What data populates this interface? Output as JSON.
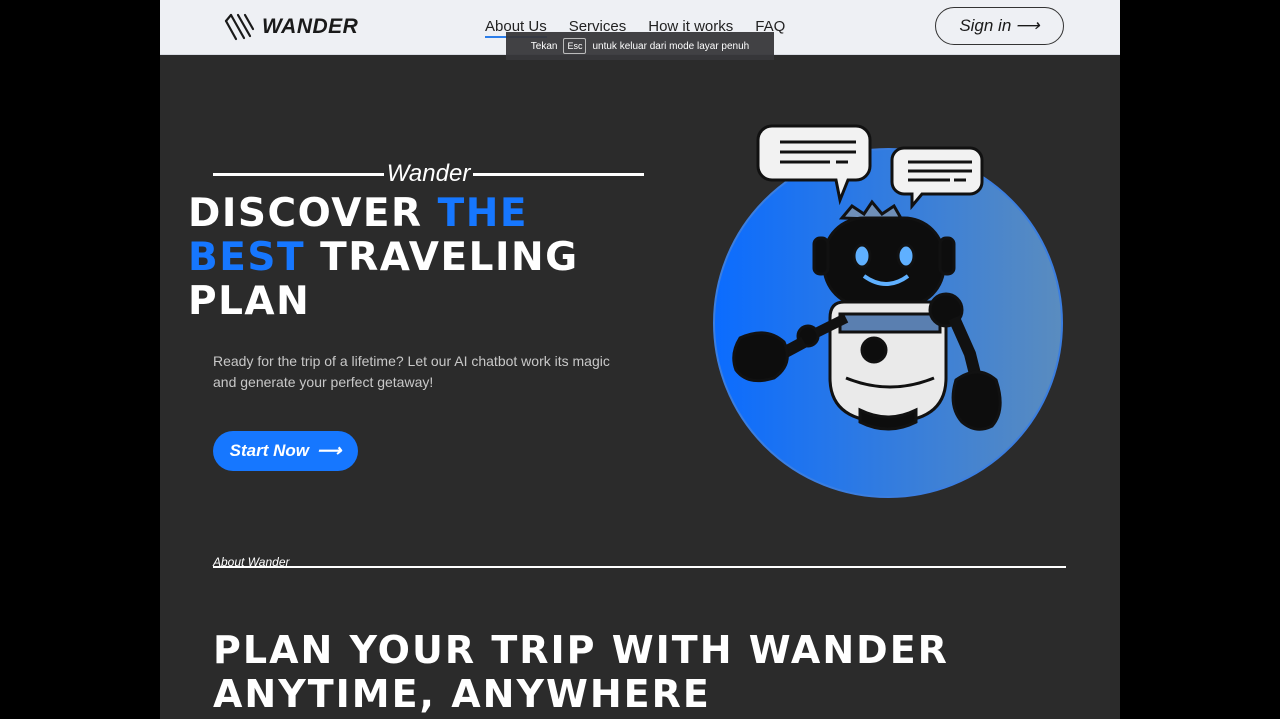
{
  "header": {
    "logo_text": "WANDER",
    "nav": [
      {
        "label": "About Us",
        "active": true
      },
      {
        "label": "Services"
      },
      {
        "label": "How it works"
      },
      {
        "label": "FAQ"
      }
    ],
    "signin_label": "Sign in",
    "signin_arrow": "⟶"
  },
  "fullscreen_toast": {
    "prefix": "Tekan",
    "key": "Esc",
    "suffix": "untuk keluar dari mode layar penuh"
  },
  "hero": {
    "eyebrow": "Wander",
    "headline": {
      "part1": "DISCOVER ",
      "part2_blue": "THE BEST",
      "part3": " TRAVELING PLAN"
    },
    "description": "Ready for the trip of a lifetime? Let our AI chatbot work its magic and generate your perfect getaway!",
    "cta_label": "Start Now",
    "cta_arrow": "⟶"
  },
  "about": {
    "label": "About Wander",
    "heading": "PLAN YOUR TRIP WITH WANDER ANYTIME, ANYWHERE"
  },
  "colors": {
    "accent": "#1677ff",
    "page_bg": "#2b2b2b",
    "header_bg": "#eef0f4"
  },
  "icons": [
    "wander-logo-icon",
    "arrow-right-icon",
    "robot-chatbot-illustration",
    "speech-bubble-icon"
  ]
}
